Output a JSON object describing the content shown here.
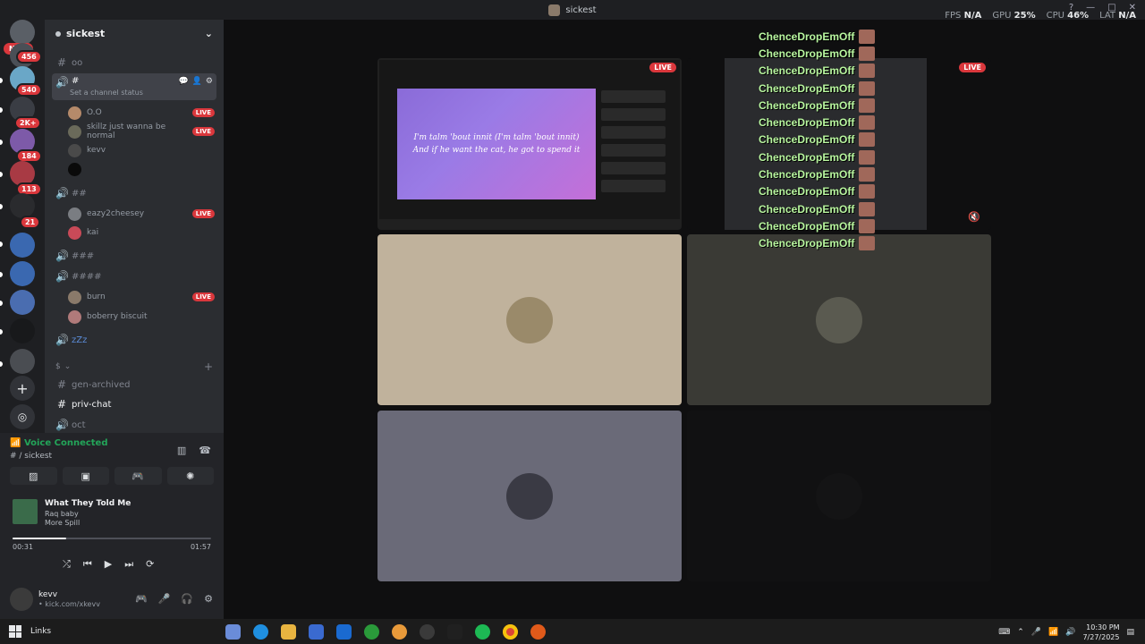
{
  "window": {
    "title": "sickest"
  },
  "perf": {
    "fps_label": "FPS",
    "fps_value": "N/A",
    "gpu_label": "GPU",
    "gpu_value": "25%",
    "cpu_label": "CPU",
    "cpu_value": "46%",
    "lat_label": "LAT",
    "lat_value": "N/A"
  },
  "guilds": {
    "new_label": "NEW",
    "badges": [
      "456",
      "540",
      "2K+",
      "184",
      "113",
      "21"
    ]
  },
  "server": {
    "name": "sickest",
    "channels": [
      {
        "icon": "text",
        "name": "oo"
      },
      {
        "icon": "voice",
        "name": "#",
        "status": "Set a channel status"
      },
      {
        "icon": "voice",
        "name": "##"
      },
      {
        "icon": "voice",
        "name": "###"
      },
      {
        "icon": "voice",
        "name": "####"
      },
      {
        "icon": "voice",
        "name": "zZz"
      },
      {
        "icon": "text",
        "name": "gen-archived"
      },
      {
        "icon": "text",
        "name": "priv-chat"
      },
      {
        "icon": "voice",
        "name": "oct"
      }
    ],
    "category": "$",
    "voice_users_1": [
      {
        "name": "O.O",
        "live": true
      },
      {
        "name": "skillz just wanna be normal",
        "live": true
      },
      {
        "name": "kevv",
        "live": false
      },
      {
        "name": "",
        "live": false
      }
    ],
    "voice_users_2": [
      {
        "name": "eazy2cheesey",
        "live": true
      },
      {
        "name": "kai",
        "live": false
      }
    ],
    "voice_users_4": [
      {
        "name": "burn",
        "live": true
      },
      {
        "name": "boberry biscuit",
        "live": false
      }
    ],
    "live_label": "LIVE"
  },
  "voice": {
    "status": "Voice Connected",
    "channel": "# / sickest"
  },
  "music": {
    "title": "What They Told Me",
    "artist": "Raq baby",
    "album": "More Spill",
    "current": "00:31",
    "duration": "01:57",
    "progress": 0.27
  },
  "user": {
    "name": "kevv",
    "status": "• kick.com/xkevv"
  },
  "stage": {
    "live_label": "LIVE",
    "lyric_line1": "I'm talm 'bout innit (I'm talm 'bout innit)",
    "lyric_line2": "And if he want the cat, he got to spend it",
    "overlay_text": "ChenceDropEmOff"
  },
  "taskbar": {
    "links": "Links",
    "time": "10:30 PM",
    "date": "7/27/2025"
  }
}
